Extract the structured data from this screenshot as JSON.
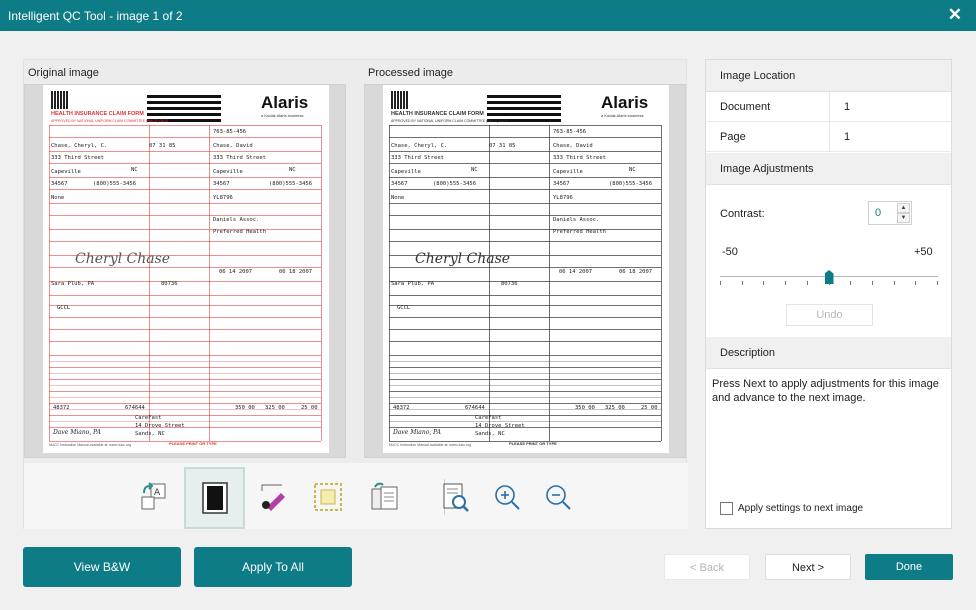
{
  "window": {
    "title": "Intelligent QC Tool - image 1 of 2",
    "close_glyph": "✕"
  },
  "images": {
    "original_label": "Original image",
    "processed_label": "Processed image",
    "doc": {
      "brand": "Alaris",
      "brand_sub": "a Kodak Alaris business",
      "form_title": "HEALTH INSURANCE CLAIM FORM",
      "form_sub": "APPROVED BY NATIONAL UNIFORM CLAIM COMMITTEE (NUCC) 02/12",
      "insured_id": "763-85-456",
      "patient_name": "Chase, Cheryl, C.",
      "insured_name": "Chase, David",
      "birth": "07 31 85",
      "address": "333 Third Street",
      "city": "Capeville",
      "state": "NC",
      "zip": "34567",
      "phone": "(800)555-3456",
      "group": "YL8796",
      "other_insured": "None",
      "employer": "Daniels Assoc.",
      "plan": "Preferred Health",
      "signature": "Cheryl Chase",
      "dates_from": "06 14 2007",
      "dates_to": "06 18 2007",
      "referring": "Sara Plub, PA",
      "npi": "80736",
      "diag": "GCCL",
      "tax_id": "48372",
      "account": "674644",
      "total": "350 00",
      "paid": "325 00",
      "balance": "25 00",
      "facility_name": "CareFast",
      "facility_addr": "14 Drove Street",
      "facility_city": "Sands, NC",
      "provider_sig": "Dave Miano, PA",
      "footer_left": "NUCC Instruction Manual available at: www.nucc.org",
      "footer_mid": "PLEASE PRINT OR TYPE"
    }
  },
  "toolbar": {
    "tools": [
      {
        "name": "rotate-tool-icon"
      },
      {
        "name": "bw-toggle-icon"
      },
      {
        "name": "pen-tool-icon"
      },
      {
        "name": "crop-tool-icon"
      },
      {
        "name": "copy-pages-icon"
      },
      {
        "name": "document-search-icon"
      },
      {
        "name": "zoom-in-icon"
      },
      {
        "name": "zoom-out-icon"
      }
    ]
  },
  "right_panel": {
    "image_location_header": "Image Location",
    "document_label": "Document",
    "document_value": "1",
    "page_label": "Page",
    "page_value": "1",
    "adjustments_header": "Image Adjustments",
    "contrast_label": "Contrast:",
    "contrast_value": "0",
    "range_min": "-50",
    "range_max": "+50",
    "contrast_level": 0,
    "undo_label": "Undo",
    "description_header": "Description",
    "description_text": "Press Next to apply adjustments for this image and advance to the next image.",
    "apply_next_label": "Apply settings to next image"
  },
  "buttons": {
    "view_bw": "View B&W",
    "apply_all": "Apply To All",
    "back": "< Back",
    "next": "Next >",
    "done": "Done"
  },
  "colors": {
    "accent": "#0e7c86",
    "form_red": "#d33333"
  }
}
